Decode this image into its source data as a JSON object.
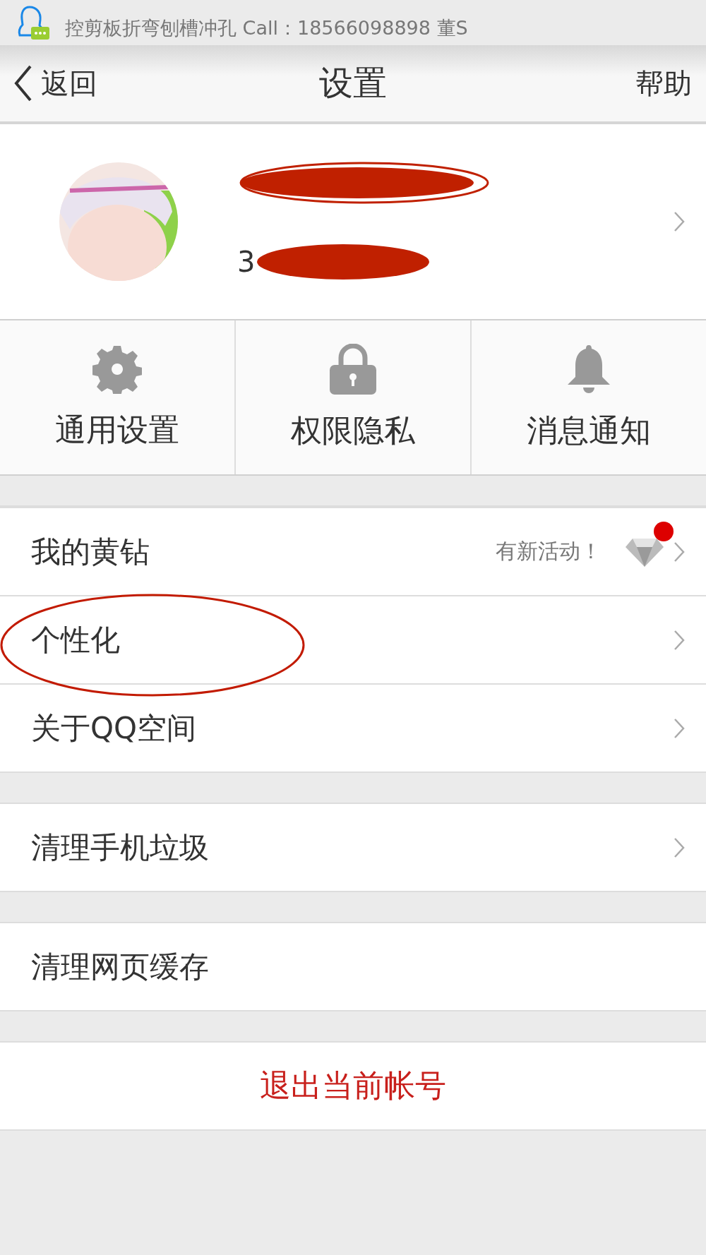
{
  "notification": {
    "text": "控剪板折弯刨槽冲孔 Call：18566098898 董S"
  },
  "header": {
    "back": "返回",
    "title": "设置",
    "help": "帮助"
  },
  "profile": {
    "kind": "picture",
    "account": "3"
  },
  "shortcuts": [
    {
      "label": "通用设置",
      "kind": "gear"
    },
    {
      "label": "权限隐私",
      "kind": "lock"
    },
    {
      "label": "消息通知",
      "kind": "bell"
    }
  ],
  "groups": [
    [
      {
        "label": "我的黄钻",
        "kind": "badge",
        "note": "有新活动！",
        "circled": false
      },
      {
        "label": "个性化",
        "kind": "plain",
        "circled": true
      },
      {
        "label": "关于QQ空间",
        "kind": "plain",
        "circled": false
      }
    ],
    [
      {
        "label": "清理手机垃圾",
        "kind": "plain",
        "circled": false
      }
    ],
    [
      {
        "label": "清理网页缓存",
        "kind": "action",
        "circled": false
      }
    ]
  ],
  "logout": "退出当前帐号"
}
